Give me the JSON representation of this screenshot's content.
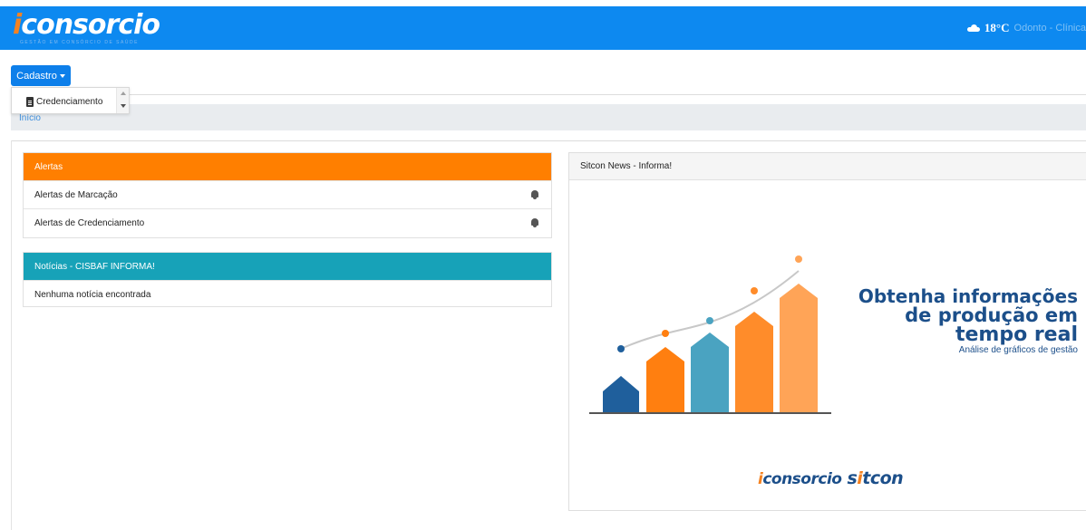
{
  "header": {
    "logo_text": "iconsorcio",
    "logo_subtitle": "GESTÃO EM CONSÓRCIO DE SAÚDE",
    "weather_icon": "cloud-icon",
    "temperature": "18°C",
    "location": "Odonto - Clínica"
  },
  "menu": {
    "cadastro_label": "Cadastro",
    "dropdown_items": [
      {
        "label": "Credenciamento",
        "icon": "document-icon"
      }
    ]
  },
  "breadcrumb": {
    "home": "Início"
  },
  "alerts": {
    "title": "Alertas",
    "header_color": "#ff7f00",
    "items": [
      {
        "label": "Alertas de Marcação",
        "icon": "bell-icon"
      },
      {
        "label": "Alertas de Credenciamento",
        "icon": "bell-icon"
      }
    ]
  },
  "news_cisbaf": {
    "title": "Notícias - CISBAF INFORMA!",
    "header_color": "#17a2b8",
    "empty_text": "Nenhuma notícia encontrada"
  },
  "news_sitcon": {
    "title": "Sitcon News - Informa!",
    "banner": {
      "headline_1": "Obtenha informações",
      "headline_2": "de produção em",
      "headline_3": "tempo real",
      "subline": "Análise de gráficos de gestão",
      "bar_colors": [
        "#1f5f9c",
        "#ff7f10",
        "#4aa3c1",
        "#ff8c2a",
        "#ffa457"
      ],
      "brand_1": "iconsorcio",
      "brand_2": "sitcon"
    }
  },
  "colors": {
    "topbar": "#0d89f0",
    "accent_orange": "#f58220",
    "brand_navy": "#1c4f8a"
  }
}
